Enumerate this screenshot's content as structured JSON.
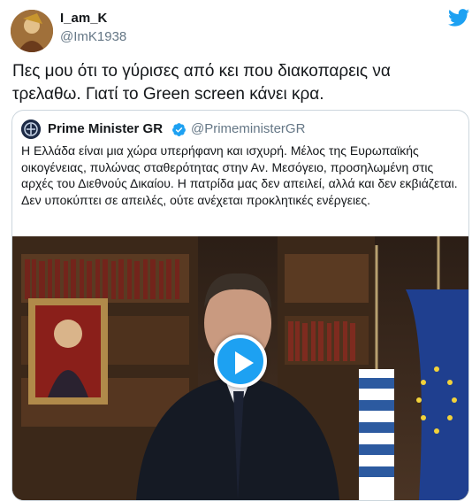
{
  "author": {
    "name": "I_am_K",
    "handle": "@ImK1938",
    "avatar_icon": "profile-avatar-icon"
  },
  "tweet": {
    "text": "Πες μου ότι το γύρισες από κει που διακοπαρεις να τρελαθω. Γιατί το Green screen κάνει κρα."
  },
  "quoted_tweet": {
    "name": "Prime Minister GR",
    "handle": "@PrimeministerGR",
    "verified": true,
    "text": "Η Ελλάδα είναι μια χώρα υπερήφανη και ισχυρή. Μέλος της Ευρωπαϊκής οικογένειας, πυλώνας σταθερότητας στην Αν. Μεσόγειο, προσηλωμένη στις αρχές του Διεθνούς Δικαίου. Η πατρίδα μας δεν απειλεί, αλλά και δεν εκβιάζεται. Δεν υποκύπτει σε απειλές, ούτε ανέχεται προκλητικές ενέργειες."
  },
  "icons": {
    "twitter": "twitter-bird-icon",
    "verified": "verified-badge-icon",
    "play": "play-icon"
  },
  "colors": {
    "accent": "#1da1f2",
    "secondary_text": "#657786",
    "border": "#ccd6dd"
  }
}
